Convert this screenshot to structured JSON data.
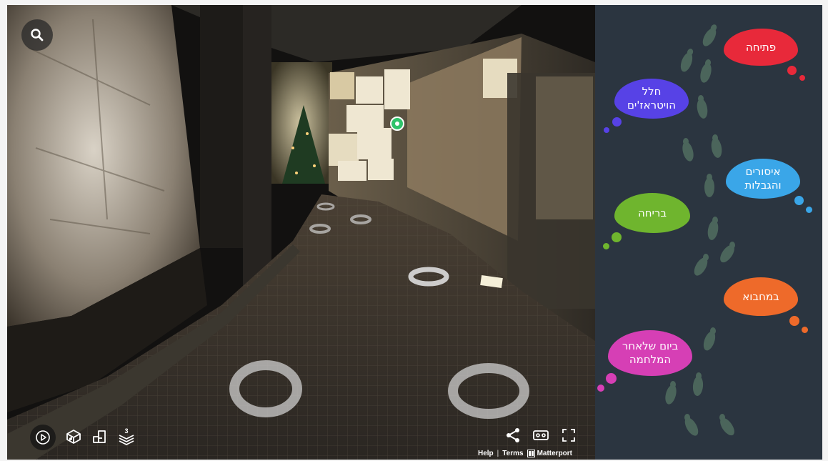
{
  "viewer": {
    "controls": {
      "search": "search-icon",
      "play": "play-icon",
      "dollhouse": "dollhouse-icon",
      "floorplan": "floorplan-icon",
      "floors": "floors-icon",
      "floors_badge": "3",
      "share": "share-icon",
      "vr": "vr-icon",
      "fullscreen": "fullscreen-icon"
    },
    "footer": {
      "help": "Help",
      "separator": "|",
      "terms": "Terms",
      "brand": "Matterport"
    }
  },
  "menu": {
    "items": [
      {
        "label": "פתיחה",
        "color": "#e8293a"
      },
      {
        "label": "חלל\nהויטראז'ים",
        "color": "#5742e6"
      },
      {
        "label": "איסורים\nוהגבלות",
        "color": "#3aa6e8"
      },
      {
        "label": "בריחה",
        "color": "#6fb52e"
      },
      {
        "label": "במחבוא",
        "color": "#ee6a2a"
      },
      {
        "label": "ביום שלאחר\nהמלחמה",
        "color": "#d63fb5"
      }
    ],
    "footprint_color": "#4f6b5e"
  }
}
